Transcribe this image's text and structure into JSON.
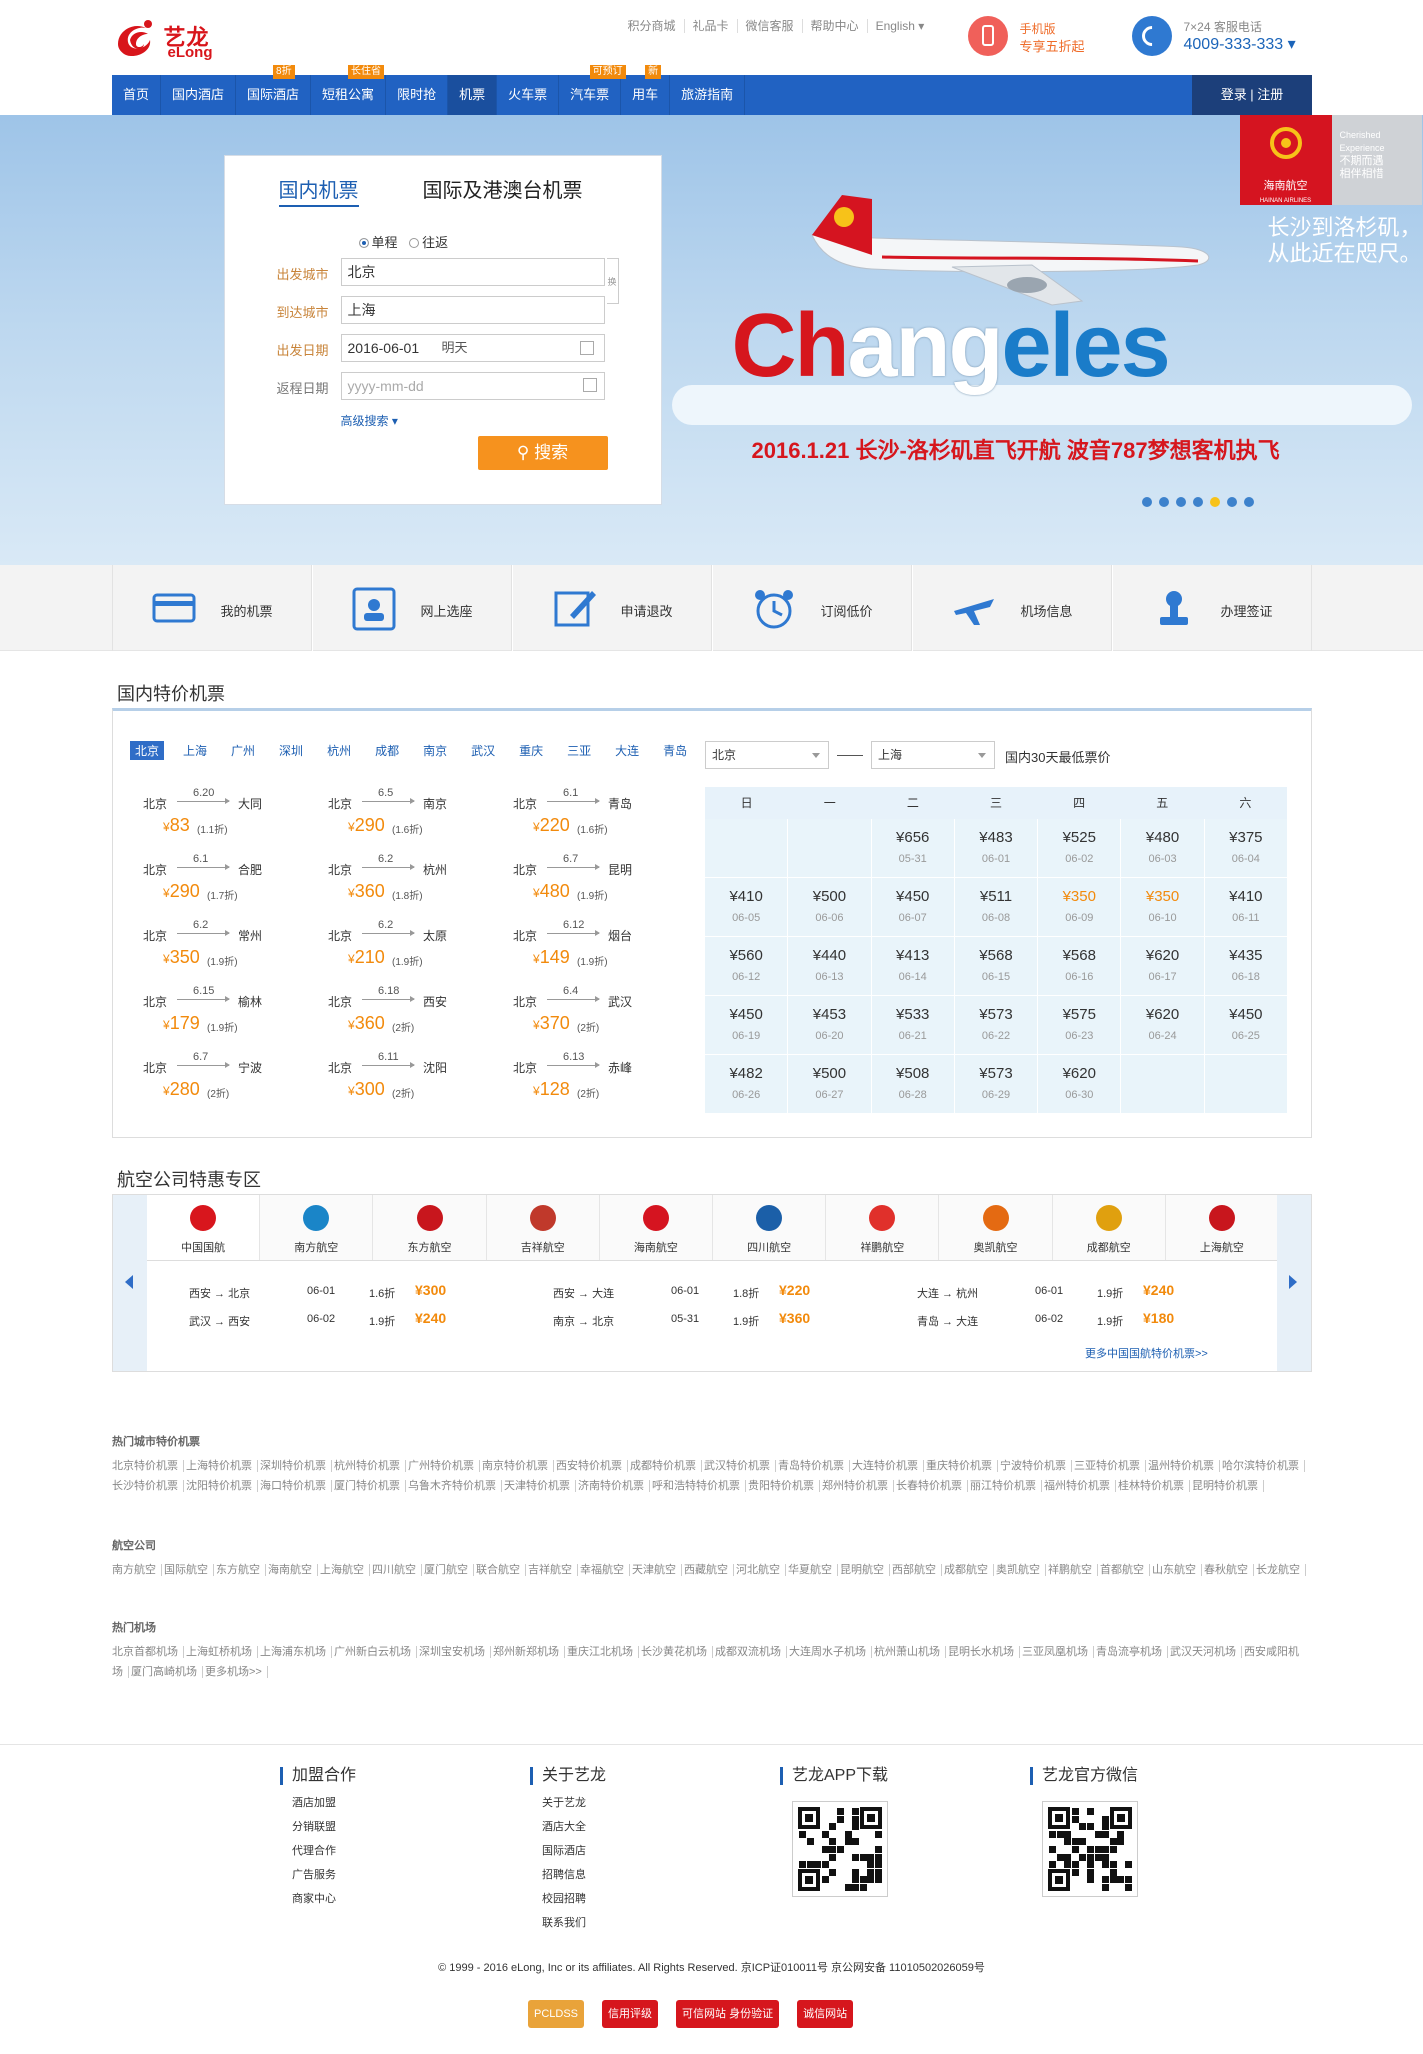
{
  "brand": {
    "cn": "艺龙",
    "en": "eLong"
  },
  "toplinks": [
    "积分商城",
    "礼品卡",
    "微信客服",
    "帮助中心",
    "English ▾"
  ],
  "mobile": {
    "line1": "手机版",
    "line2": "专享五折起"
  },
  "hotline": {
    "line1": "7×24 客服电话",
    "number": "4009-333-333 ▾"
  },
  "nav": {
    "items": [
      {
        "label": "首页",
        "badge": ""
      },
      {
        "label": "国内酒店",
        "badge": ""
      },
      {
        "label": "国际酒店",
        "badge": "8折"
      },
      {
        "label": "短租公寓",
        "badge": "长住省"
      },
      {
        "label": "限时抢",
        "badge": ""
      },
      {
        "label": "机票",
        "badge": ""
      },
      {
        "label": "火车票",
        "badge": ""
      },
      {
        "label": "汽车票",
        "badge": "可预订"
      },
      {
        "label": "用车",
        "badge": "新"
      },
      {
        "label": "旅游指南",
        "badge": ""
      }
    ],
    "login": "登录 | 注册"
  },
  "search": {
    "tab_domestic": "国内机票",
    "tab_intl": "国际及港澳台机票",
    "trip_oneway": "单程",
    "trip_round": "往返",
    "from_label": "出发城市",
    "from_value": "北京",
    "to_label": "到达城市",
    "to_value": "上海",
    "swap": "换",
    "depart_label": "出发日期",
    "depart_value": "2016-06-01",
    "depart_sub": "明天",
    "return_label": "返程日期",
    "return_placeholder": "yyyy-mm-dd",
    "advanced": "高级搜索 ▾",
    "button": "搜索"
  },
  "banner": {
    "airline_name": "海南航空",
    "airline_en": "HAINAN AIRLINES",
    "tag_en1": "Cherished",
    "tag_en2": "Experience",
    "tag_cn1": "不期而遇",
    "tag_cn2": "相伴相惜",
    "slogan1": "长沙到洛杉矶，",
    "slogan2": "从此近在咫尺。",
    "word_a": "Ch",
    "word_b": "ang",
    "word_c": "eles",
    "caption": "2016.1.21 长沙-洛杉矶直飞开航 波音787梦想客机执飞",
    "slide_count": 7,
    "active_slide": 5
  },
  "quick": [
    {
      "label": "我的机票",
      "icon": "ticket-card-icon"
    },
    {
      "label": "网上选座",
      "icon": "seat-select-icon"
    },
    {
      "label": "申请退改",
      "icon": "edit-pen-icon"
    },
    {
      "label": "订阅低价",
      "icon": "alarm-clock-icon"
    },
    {
      "label": "机场信息",
      "icon": "plane-icon"
    },
    {
      "label": "办理签证",
      "icon": "stamp-icon"
    }
  ],
  "domestic": {
    "title": "国内特价机票",
    "cities": [
      "北京",
      "上海",
      "广州",
      "深圳",
      "杭州",
      "成都",
      "南京",
      "武汉",
      "重庆",
      "三亚",
      "大连",
      "青岛"
    ],
    "deals": [
      {
        "from": "北京",
        "to": "大同",
        "date": "6.20",
        "price": "83",
        "disc": "(1.1折)"
      },
      {
        "from": "北京",
        "to": "南京",
        "date": "6.5",
        "price": "290",
        "disc": "(1.6折)"
      },
      {
        "from": "北京",
        "to": "青岛",
        "date": "6.1",
        "price": "220",
        "disc": "(1.6折)"
      },
      {
        "from": "北京",
        "to": "合肥",
        "date": "6.1",
        "price": "290",
        "disc": "(1.7折)"
      },
      {
        "from": "北京",
        "to": "杭州",
        "date": "6.2",
        "price": "360",
        "disc": "(1.8折)"
      },
      {
        "from": "北京",
        "to": "昆明",
        "date": "6.7",
        "price": "480",
        "disc": "(1.9折)"
      },
      {
        "from": "北京",
        "to": "常州",
        "date": "6.2",
        "price": "350",
        "disc": "(1.9折)"
      },
      {
        "from": "北京",
        "to": "太原",
        "date": "6.2",
        "price": "210",
        "disc": "(1.9折)"
      },
      {
        "from": "北京",
        "to": "烟台",
        "date": "6.12",
        "price": "149",
        "disc": "(1.9折)"
      },
      {
        "from": "北京",
        "to": "榆林",
        "date": "6.15",
        "price": "179",
        "disc": "(1.9折)"
      },
      {
        "from": "北京",
        "to": "西安",
        "date": "6.18",
        "price": "360",
        "disc": "(2折)"
      },
      {
        "from": "北京",
        "to": "武汉",
        "date": "6.4",
        "price": "370",
        "disc": "(2折)"
      },
      {
        "from": "北京",
        "to": "宁波",
        "date": "6.7",
        "price": "280",
        "disc": "(2折)"
      },
      {
        "from": "北京",
        "to": "沈阳",
        "date": "6.11",
        "price": "300",
        "disc": "(2折)"
      },
      {
        "from": "北京",
        "to": "赤峰",
        "date": "6.13",
        "price": "128",
        "disc": "(2折)"
      }
    ],
    "currency": "¥",
    "calendar": {
      "from": "北京",
      "to": "上海",
      "caption": "国内30天最低票价",
      "weekdays": [
        "日",
        "一",
        "二",
        "三",
        "四",
        "五",
        "六"
      ],
      "cells": [
        {
          "p": "",
          "d": ""
        },
        {
          "p": "",
          "d": ""
        },
        {
          "p": "¥656",
          "d": "05-31"
        },
        {
          "p": "¥483",
          "d": "06-01"
        },
        {
          "p": "¥525",
          "d": "06-02"
        },
        {
          "p": "¥480",
          "d": "06-03"
        },
        {
          "p": "¥375",
          "d": "06-04"
        },
        {
          "p": "¥410",
          "d": "06-05"
        },
        {
          "p": "¥500",
          "d": "06-06"
        },
        {
          "p": "¥450",
          "d": "06-07"
        },
        {
          "p": "¥511",
          "d": "06-08"
        },
        {
          "p": "¥350",
          "d": "06-09",
          "hot": true
        },
        {
          "p": "¥350",
          "d": "06-10",
          "hot": true
        },
        {
          "p": "¥410",
          "d": "06-11"
        },
        {
          "p": "¥560",
          "d": "06-12"
        },
        {
          "p": "¥440",
          "d": "06-13"
        },
        {
          "p": "¥413",
          "d": "06-14"
        },
        {
          "p": "¥568",
          "d": "06-15"
        },
        {
          "p": "¥568",
          "d": "06-16"
        },
        {
          "p": "¥620",
          "d": "06-17"
        },
        {
          "p": "¥435",
          "d": "06-18"
        },
        {
          "p": "¥450",
          "d": "06-19"
        },
        {
          "p": "¥453",
          "d": "06-20"
        },
        {
          "p": "¥533",
          "d": "06-21"
        },
        {
          "p": "¥573",
          "d": "06-22"
        },
        {
          "p": "¥575",
          "d": "06-23"
        },
        {
          "p": "¥620",
          "d": "06-24"
        },
        {
          "p": "¥450",
          "d": "06-25"
        },
        {
          "p": "¥482",
          "d": "06-26"
        },
        {
          "p": "¥500",
          "d": "06-27"
        },
        {
          "p": "¥508",
          "d": "06-28"
        },
        {
          "p": "¥573",
          "d": "06-29"
        },
        {
          "p": "¥620",
          "d": "06-30"
        },
        {
          "p": "",
          "d": ""
        },
        {
          "p": "",
          "d": ""
        }
      ]
    }
  },
  "airline": {
    "title": "航空公司特惠专区",
    "logos": [
      {
        "name": "中国国航",
        "color": "#d8161d"
      },
      {
        "name": "南方航空",
        "color": "#1a85c8"
      },
      {
        "name": "东方航空",
        "color": "#c8161d"
      },
      {
        "name": "吉祥航空",
        "color": "#c0392b"
      },
      {
        "name": "海南航空",
        "color": "#d51420"
      },
      {
        "name": "四川航空",
        "color": "#1b5fa8"
      },
      {
        "name": "祥鹏航空",
        "color": "#e0302b"
      },
      {
        "name": "奥凯航空",
        "color": "#e46a12"
      },
      {
        "name": "成都航空",
        "color": "#e0a00f"
      },
      {
        "name": "上海航空",
        "color": "#c8161d"
      }
    ],
    "routes": [
      {
        "route": "西安 → 北京",
        "date": "06-01",
        "disc": "1.6折",
        "price": "¥300"
      },
      {
        "route": "武汉 → 西安",
        "date": "06-02",
        "disc": "1.9折",
        "price": "¥240"
      },
      {
        "route": "西安 → 大连",
        "date": "06-01",
        "disc": "1.8折",
        "price": "¥220"
      },
      {
        "route": "南京 → 北京",
        "date": "05-31",
        "disc": "1.9折",
        "price": "¥360"
      },
      {
        "route": "大连 → 杭州",
        "date": "06-01",
        "disc": "1.9折",
        "price": "¥240"
      },
      {
        "route": "青岛 → 大连",
        "date": "06-02",
        "disc": "1.9折",
        "price": "¥180"
      }
    ],
    "more": "更多中国国航特价机票>>"
  },
  "links": {
    "hot_title": "热门城市特价机票",
    "hot": [
      "北京特价机票",
      "上海特价机票",
      "深圳特价机票",
      "杭州特价机票",
      "广州特价机票",
      "南京特价机票",
      "西安特价机票",
      "成都特价机票",
      "武汉特价机票",
      "青岛特价机票",
      "大连特价机票",
      "重庆特价机票",
      "宁波特价机票",
      "三亚特价机票",
      "温州特价机票",
      "哈尔滨特价机票",
      "长沙特价机票",
      "沈阳特价机票",
      "海口特价机票",
      "厦门特价机票",
      "乌鲁木齐特价机票",
      "天津特价机票",
      "济南特价机票",
      "呼和浩特特价机票",
      "贵阳特价机票",
      "郑州特价机票",
      "长春特价机票",
      "丽江特价机票",
      "福州特价机票",
      "桂林特价机票",
      "昆明特价机票"
    ],
    "air_title": "航空公司",
    "air": [
      "南方航空",
      "国际航空",
      "东方航空",
      "海南航空",
      "上海航空",
      "四川航空",
      "厦门航空",
      "联合航空",
      "吉祥航空",
      "幸福航空",
      "天津航空",
      "西藏航空",
      "河北航空",
      "华夏航空",
      "昆明航空",
      "西部航空",
      "成都航空",
      "奥凯航空",
      "祥鹏航空",
      "首都航空",
      "山东航空",
      "春秋航空",
      "长龙航空"
    ],
    "port_title": "热门机场",
    "port": [
      "北京首都机场",
      "上海虹桥机场",
      "上海浦东机场",
      "广州新白云机场",
      "深圳宝安机场",
      "郑州新郑机场",
      "重庆江北机场",
      "长沙黄花机场",
      "成都双流机场",
      "大连周水子机场",
      "杭州萧山机场",
      "昆明长水机场",
      "三亚凤凰机场",
      "青岛流亭机场",
      "武汉天河机场",
      "西安咸阳机场",
      "厦门高崎机场",
      "更多机场>>"
    ]
  },
  "footer": {
    "join_title": "加盟合作",
    "join": [
      "酒店加盟",
      "分销联盟",
      "代理合作",
      "广告服务",
      "商家中心"
    ],
    "about_title": "关于艺龙",
    "about": [
      "关于艺龙",
      "酒店大全",
      "国际酒店",
      "招聘信息",
      "校园招聘",
      "联系我们"
    ],
    "app_title": "艺龙APP下载",
    "wechat_title": "艺龙官方微信",
    "copyright": "© 1999 - 2016 eLong, Inc or its affiliates. All Rights Reserved. 京ICP证010011号 京公网安备 11010502026059号",
    "certs": [
      "PCLDSS",
      "信用评级",
      "可信网站 身份验证",
      "诚信网站"
    ]
  }
}
